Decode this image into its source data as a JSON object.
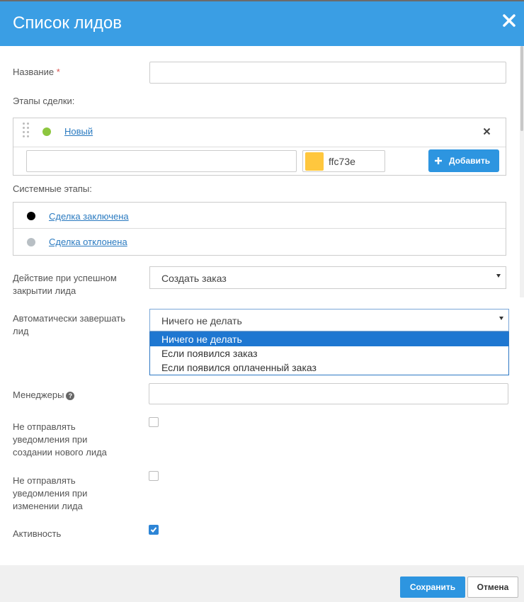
{
  "header": {
    "title": "Список лидов"
  },
  "form": {
    "name_label": "Название",
    "name_required": "*",
    "name_value": "",
    "stages_label": "Этапы сделки",
    "stages_colon": ":",
    "stages": [
      {
        "name": "Новый",
        "color": "#8dc63f"
      }
    ],
    "new_stage": {
      "name_value": "",
      "color_value": "ffc73e",
      "color_hex": "#ffc73e",
      "add_label": "Добавить"
    },
    "system_stages_label": "Системные этапы:",
    "system_stages": [
      {
        "name": "Сделка заключена",
        "color": "#000000"
      },
      {
        "name": "Сделка отклонена",
        "color": "#b8bfc4"
      }
    ],
    "success_action_label_1": "Действие при успешном",
    "success_action_label_2": "закрытии лида",
    "success_action_value": "Создать заказ",
    "auto_finish_label_1": "Автоматически завершать",
    "auto_finish_label_2": "лид",
    "auto_finish_value": "Ничего не делать",
    "auto_finish_options": [
      "Ничего не делать",
      "Если появился заказ",
      "Если появился оплаченный заказ"
    ],
    "managers_label": "Менеджеры",
    "managers_help": "?",
    "no_notify_create_label": [
      "Не отправлять",
      "уведомления при",
      "создании нового лида"
    ],
    "no_notify_create_checked": false,
    "no_notify_change_label": [
      "Не отправлять",
      "уведомления при",
      "изменении лида"
    ],
    "no_notify_change_checked": false,
    "active_label": "Активность",
    "active_checked": true
  },
  "footer": {
    "save_label": "Сохранить",
    "cancel_label": "Отмена"
  }
}
